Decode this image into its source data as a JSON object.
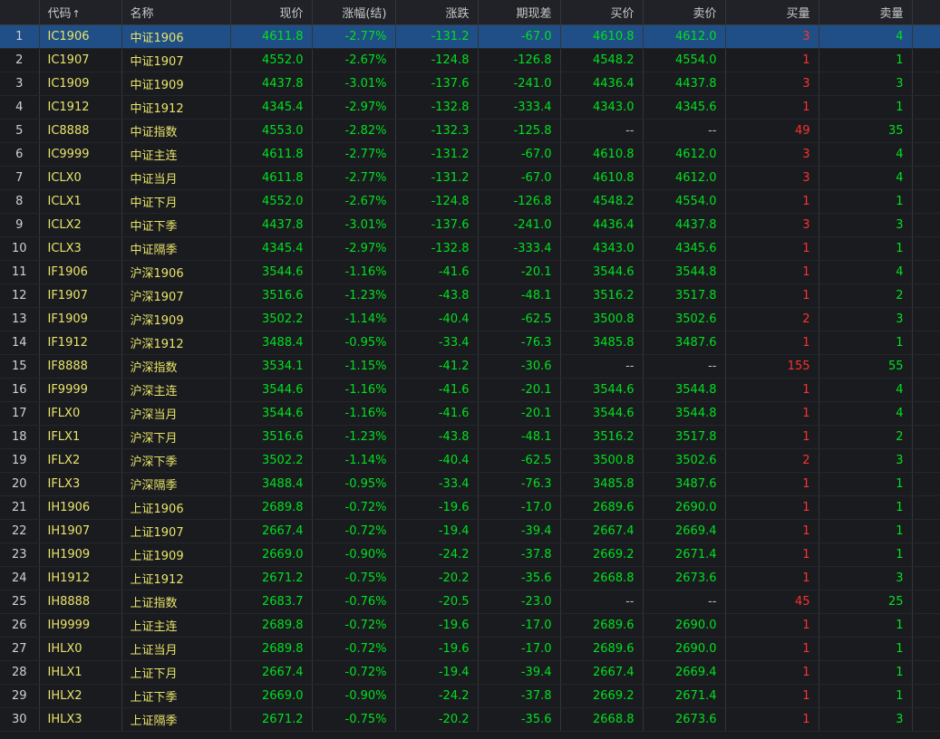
{
  "columns": {
    "code": "代码",
    "code_sort": "↑",
    "name": "名称",
    "price": "现价",
    "pct": "涨幅(结)",
    "chg": "涨跌",
    "basis": "期现差",
    "bid": "买价",
    "ask": "卖价",
    "bidvol": "买量",
    "askvol": "卖量"
  },
  "colors": {
    "up": "#ff3030",
    "down": "#00e01e",
    "code": "#e8e46a",
    "selected": "#1f4f86"
  },
  "selected_row": 1,
  "rows": [
    {
      "idx": "1",
      "code": "IC1906",
      "name": "中证1906",
      "price": "4611.8",
      "pct": "-2.77%",
      "chg": "-131.2",
      "basis": "-67.0",
      "bid": "4610.8",
      "ask": "4612.0",
      "bidvol": "3",
      "askvol": "4"
    },
    {
      "idx": "2",
      "code": "IC1907",
      "name": "中证1907",
      "price": "4552.0",
      "pct": "-2.67%",
      "chg": "-124.8",
      "basis": "-126.8",
      "bid": "4548.2",
      "ask": "4554.0",
      "bidvol": "1",
      "askvol": "1"
    },
    {
      "idx": "3",
      "code": "IC1909",
      "name": "中证1909",
      "price": "4437.8",
      "pct": "-3.01%",
      "chg": "-137.6",
      "basis": "-241.0",
      "bid": "4436.4",
      "ask": "4437.8",
      "bidvol": "3",
      "askvol": "3"
    },
    {
      "idx": "4",
      "code": "IC1912",
      "name": "中证1912",
      "price": "4345.4",
      "pct": "-2.97%",
      "chg": "-132.8",
      "basis": "-333.4",
      "bid": "4343.0",
      "ask": "4345.6",
      "bidvol": "1",
      "askvol": "1"
    },
    {
      "idx": "5",
      "code": "IC8888",
      "name": "中证指数",
      "price": "4553.0",
      "pct": "-2.82%",
      "chg": "-132.3",
      "basis": "-125.8",
      "bid": "--",
      "ask": "--",
      "bidvol": "49",
      "askvol": "35"
    },
    {
      "idx": "6",
      "code": "IC9999",
      "name": "中证主连",
      "price": "4611.8",
      "pct": "-2.77%",
      "chg": "-131.2",
      "basis": "-67.0",
      "bid": "4610.8",
      "ask": "4612.0",
      "bidvol": "3",
      "askvol": "4"
    },
    {
      "idx": "7",
      "code": "ICLX0",
      "name": "中证当月",
      "price": "4611.8",
      "pct": "-2.77%",
      "chg": "-131.2",
      "basis": "-67.0",
      "bid": "4610.8",
      "ask": "4612.0",
      "bidvol": "3",
      "askvol": "4"
    },
    {
      "idx": "8",
      "code": "ICLX1",
      "name": "中证下月",
      "price": "4552.0",
      "pct": "-2.67%",
      "chg": "-124.8",
      "basis": "-126.8",
      "bid": "4548.2",
      "ask": "4554.0",
      "bidvol": "1",
      "askvol": "1"
    },
    {
      "idx": "9",
      "code": "ICLX2",
      "name": "中证下季",
      "price": "4437.8",
      "pct": "-3.01%",
      "chg": "-137.6",
      "basis": "-241.0",
      "bid": "4436.4",
      "ask": "4437.8",
      "bidvol": "3",
      "askvol": "3"
    },
    {
      "idx": "10",
      "code": "ICLX3",
      "name": "中证隔季",
      "price": "4345.4",
      "pct": "-2.97%",
      "chg": "-132.8",
      "basis": "-333.4",
      "bid": "4343.0",
      "ask": "4345.6",
      "bidvol": "1",
      "askvol": "1"
    },
    {
      "idx": "11",
      "code": "IF1906",
      "name": "沪深1906",
      "price": "3544.6",
      "pct": "-1.16%",
      "chg": "-41.6",
      "basis": "-20.1",
      "bid": "3544.6",
      "ask": "3544.8",
      "bidvol": "1",
      "askvol": "4"
    },
    {
      "idx": "12",
      "code": "IF1907",
      "name": "沪深1907",
      "price": "3516.6",
      "pct": "-1.23%",
      "chg": "-43.8",
      "basis": "-48.1",
      "bid": "3516.2",
      "ask": "3517.8",
      "bidvol": "1",
      "askvol": "2"
    },
    {
      "idx": "13",
      "code": "IF1909",
      "name": "沪深1909",
      "price": "3502.2",
      "pct": "-1.14%",
      "chg": "-40.4",
      "basis": "-62.5",
      "bid": "3500.8",
      "ask": "3502.6",
      "bidvol": "2",
      "askvol": "3"
    },
    {
      "idx": "14",
      "code": "IF1912",
      "name": "沪深1912",
      "price": "3488.4",
      "pct": "-0.95%",
      "chg": "-33.4",
      "basis": "-76.3",
      "bid": "3485.8",
      "ask": "3487.6",
      "bidvol": "1",
      "askvol": "1"
    },
    {
      "idx": "15",
      "code": "IF8888",
      "name": "沪深指数",
      "price": "3534.1",
      "pct": "-1.15%",
      "chg": "-41.2",
      "basis": "-30.6",
      "bid": "--",
      "ask": "--",
      "bidvol": "155",
      "askvol": "55"
    },
    {
      "idx": "16",
      "code": "IF9999",
      "name": "沪深主连",
      "price": "3544.6",
      "pct": "-1.16%",
      "chg": "-41.6",
      "basis": "-20.1",
      "bid": "3544.6",
      "ask": "3544.8",
      "bidvol": "1",
      "askvol": "4"
    },
    {
      "idx": "17",
      "code": "IFLX0",
      "name": "沪深当月",
      "price": "3544.6",
      "pct": "-1.16%",
      "chg": "-41.6",
      "basis": "-20.1",
      "bid": "3544.6",
      "ask": "3544.8",
      "bidvol": "1",
      "askvol": "4"
    },
    {
      "idx": "18",
      "code": "IFLX1",
      "name": "沪深下月",
      "price": "3516.6",
      "pct": "-1.23%",
      "chg": "-43.8",
      "basis": "-48.1",
      "bid": "3516.2",
      "ask": "3517.8",
      "bidvol": "1",
      "askvol": "2"
    },
    {
      "idx": "19",
      "code": "IFLX2",
      "name": "沪深下季",
      "price": "3502.2",
      "pct": "-1.14%",
      "chg": "-40.4",
      "basis": "-62.5",
      "bid": "3500.8",
      "ask": "3502.6",
      "bidvol": "2",
      "askvol": "3"
    },
    {
      "idx": "20",
      "code": "IFLX3",
      "name": "沪深隔季",
      "price": "3488.4",
      "pct": "-0.95%",
      "chg": "-33.4",
      "basis": "-76.3",
      "bid": "3485.8",
      "ask": "3487.6",
      "bidvol": "1",
      "askvol": "1"
    },
    {
      "idx": "21",
      "code": "IH1906",
      "name": "上证1906",
      "price": "2689.8",
      "pct": "-0.72%",
      "chg": "-19.6",
      "basis": "-17.0",
      "bid": "2689.6",
      "ask": "2690.0",
      "bidvol": "1",
      "askvol": "1"
    },
    {
      "idx": "22",
      "code": "IH1907",
      "name": "上证1907",
      "price": "2667.4",
      "pct": "-0.72%",
      "chg": "-19.4",
      "basis": "-39.4",
      "bid": "2667.4",
      "ask": "2669.4",
      "bidvol": "1",
      "askvol": "1"
    },
    {
      "idx": "23",
      "code": "IH1909",
      "name": "上证1909",
      "price": "2669.0",
      "pct": "-0.90%",
      "chg": "-24.2",
      "basis": "-37.8",
      "bid": "2669.2",
      "ask": "2671.4",
      "bidvol": "1",
      "askvol": "1"
    },
    {
      "idx": "24",
      "code": "IH1912",
      "name": "上证1912",
      "price": "2671.2",
      "pct": "-0.75%",
      "chg": "-20.2",
      "basis": "-35.6",
      "bid": "2668.8",
      "ask": "2673.6",
      "bidvol": "1",
      "askvol": "3"
    },
    {
      "idx": "25",
      "code": "IH8888",
      "name": "上证指数",
      "price": "2683.7",
      "pct": "-0.76%",
      "chg": "-20.5",
      "basis": "-23.0",
      "bid": "--",
      "ask": "--",
      "bidvol": "45",
      "askvol": "25"
    },
    {
      "idx": "26",
      "code": "IH9999",
      "name": "上证主连",
      "price": "2689.8",
      "pct": "-0.72%",
      "chg": "-19.6",
      "basis": "-17.0",
      "bid": "2689.6",
      "ask": "2690.0",
      "bidvol": "1",
      "askvol": "1"
    },
    {
      "idx": "27",
      "code": "IHLX0",
      "name": "上证当月",
      "price": "2689.8",
      "pct": "-0.72%",
      "chg": "-19.6",
      "basis": "-17.0",
      "bid": "2689.6",
      "ask": "2690.0",
      "bidvol": "1",
      "askvol": "1"
    },
    {
      "idx": "28",
      "code": "IHLX1",
      "name": "上证下月",
      "price": "2667.4",
      "pct": "-0.72%",
      "chg": "-19.4",
      "basis": "-39.4",
      "bid": "2667.4",
      "ask": "2669.4",
      "bidvol": "1",
      "askvol": "1"
    },
    {
      "idx": "29",
      "code": "IHLX2",
      "name": "上证下季",
      "price": "2669.0",
      "pct": "-0.90%",
      "chg": "-24.2",
      "basis": "-37.8",
      "bid": "2669.2",
      "ask": "2671.4",
      "bidvol": "1",
      "askvol": "1"
    },
    {
      "idx": "30",
      "code": "IHLX3",
      "name": "上证隔季",
      "price": "2671.2",
      "pct": "-0.75%",
      "chg": "-20.2",
      "basis": "-35.6",
      "bid": "2668.8",
      "ask": "2673.6",
      "bidvol": "1",
      "askvol": "3"
    }
  ]
}
